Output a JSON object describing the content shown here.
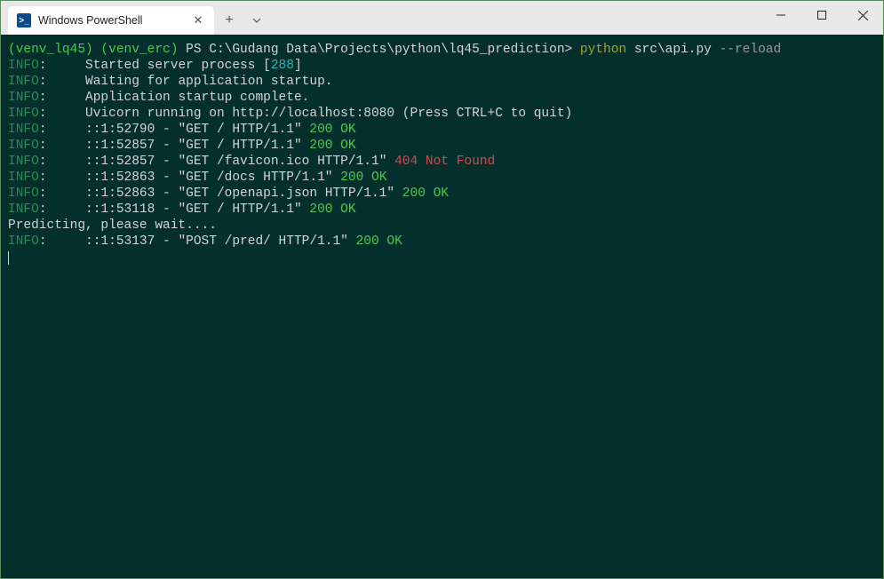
{
  "titlebar": {
    "tab_label": "Windows PowerShell",
    "icon_glyph": ">_"
  },
  "prompt": {
    "venv1": "(venv_lq45)",
    "venv2": "(venv_erc)",
    "ps": "PS",
    "path": "C:\\Gudang Data\\Projects\\python\\lq45_prediction",
    "gt": ">",
    "cmd": "python",
    "arg1": "src\\api.py",
    "arg2": "--reload"
  },
  "lines": [
    {
      "tag": "INFO",
      "pre": ":     Started server process [",
      "cyan": "288",
      "post": "]"
    },
    {
      "tag": "INFO",
      "pre": ":     Waiting for application startup."
    },
    {
      "tag": "INFO",
      "pre": ":     Application startup complete."
    },
    {
      "tag": "INFO",
      "pre": ":     Uvicorn running on ",
      "bold": "http://localhost:8080",
      "post": " (Press CTRL+C to quit)"
    },
    {
      "tag": "INFO",
      "pre": ":     ::1:52790 - \"",
      "req": "GET / HTTP/1.1",
      "mid": "\" ",
      "status": "200 OK",
      "ok": true
    },
    {
      "tag": "INFO",
      "pre": ":     ::1:52857 - \"",
      "req": "GET / HTTP/1.1",
      "mid": "\" ",
      "status": "200 OK",
      "ok": true
    },
    {
      "tag": "INFO",
      "pre": ":     ::1:52857 - \"",
      "req": "GET /favicon.ico HTTP/1.1",
      "mid": "\" ",
      "status": "404 Not Found",
      "ok": false
    },
    {
      "tag": "INFO",
      "pre": ":     ::1:52863 - \"",
      "req": "GET /docs HTTP/1.1",
      "mid": "\" ",
      "status": "200 OK",
      "ok": true
    },
    {
      "tag": "INFO",
      "pre": ":     ::1:52863 - \"",
      "req": "GET /openapi.json HTTP/1.1",
      "mid": "\" ",
      "status": "200 OK",
      "ok": true
    },
    {
      "tag": "INFO",
      "pre": ":     ::1:53118 - \"",
      "req": "GET / HTTP/1.1",
      "mid": "\" ",
      "status": "200 OK",
      "ok": true
    }
  ],
  "misc": {
    "predicting": "Predicting, please wait....",
    "last_tag": "INFO",
    "last_pre": ":     ::1:53137 - \"",
    "last_req": "POST /pred/ HTTP/1.1",
    "last_mid": "\" ",
    "last_status": "200 OK"
  }
}
